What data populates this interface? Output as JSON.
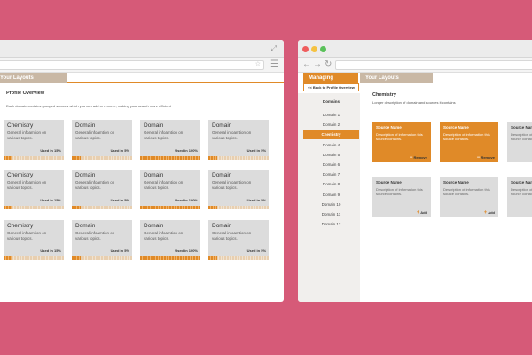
{
  "left_window": {
    "tab_label": "Your Layouts",
    "heading": "Profile Overview",
    "description": "Each domain contains grouped sources which you can add or remove, making your search more efficient",
    "cards": [
      {
        "title": "Chemistry",
        "desc": "General infoamtion on various topics.",
        "usage": "Used in 15%",
        "fill": 0.15
      },
      {
        "title": "Domain",
        "desc": "General infoamtion on various topics.",
        "usage": "Used in 5%",
        "fill": 0.05
      },
      {
        "title": "Domain",
        "desc": "General infoamtion on various topics.",
        "usage": "Used in 100%",
        "fill": 1.0
      },
      {
        "title": "Domain",
        "desc": "General infoamtion on various topics.",
        "usage": "Used in 5%",
        "fill": 0.05
      },
      {
        "title": "Chemistry",
        "desc": "General infoamtion on various topics.",
        "usage": "Used in 15%",
        "fill": 0.15
      },
      {
        "title": "Domain",
        "desc": "General infoamtion on various topics.",
        "usage": "Used in 5%",
        "fill": 0.05
      },
      {
        "title": "Domain",
        "desc": "General infoamtion on various topics.",
        "usage": "Used in 100%",
        "fill": 1.0
      },
      {
        "title": "Domain",
        "desc": "General infoamtion on various topics.",
        "usage": "Used in 5%",
        "fill": 0.05
      },
      {
        "title": "Chemistry",
        "desc": "General infoamtion on various topics.",
        "usage": "Used in 15%",
        "fill": 0.15
      },
      {
        "title": "Domain",
        "desc": "General infoamtion on various topics.",
        "usage": "Used in 5%",
        "fill": 0.05
      },
      {
        "title": "Domain",
        "desc": "General infoamtion on various topics.",
        "usage": "Used in 100%",
        "fill": 1.0
      },
      {
        "title": "Domain",
        "desc": "General infoamtion on various topics.",
        "usage": "Used in 5%",
        "fill": 0.05
      }
    ]
  },
  "right_window": {
    "tabs": [
      "Managing Sources",
      "Your Layouts"
    ],
    "back_label": "<< Back to Profile Overview",
    "sidebar_header": "Domains",
    "domains": [
      "Domain 1",
      "Domain 2",
      "Chemistry",
      "Domain 4",
      "Domain 5",
      "Domain 6",
      "Domain 7",
      "Domain 8",
      "Domain 9",
      "Domain 10",
      "Domain 11",
      "Domain 12"
    ],
    "active_domain": "Chemistry",
    "heading": "Chemistry",
    "description": "Longer description of domain and sources it contains",
    "sources": [
      {
        "title": "Source Name",
        "desc": "Description of information this source contains.",
        "action": "Remove",
        "active": true
      },
      {
        "title": "Source Name",
        "desc": "Description of information this source contains.",
        "action": "Remove",
        "active": true
      },
      {
        "title": "Source Name",
        "desc": "Description of information this source contains.",
        "action": "Add",
        "active": false
      },
      {
        "title": "Source Name",
        "desc": "Description of information this source contains.",
        "action": "Add",
        "active": false
      },
      {
        "title": "Source Name",
        "desc": "Description of information this source contains.",
        "action": "Add",
        "active": false
      },
      {
        "title": "Source Name",
        "desc": "Description of information this source contains.",
        "action": "Add",
        "active": false
      }
    ]
  },
  "colors": {
    "background": "#d65a78",
    "accent": "#e08a28",
    "muted_tab": "#c9b8a5",
    "card": "#dcdcdc"
  }
}
